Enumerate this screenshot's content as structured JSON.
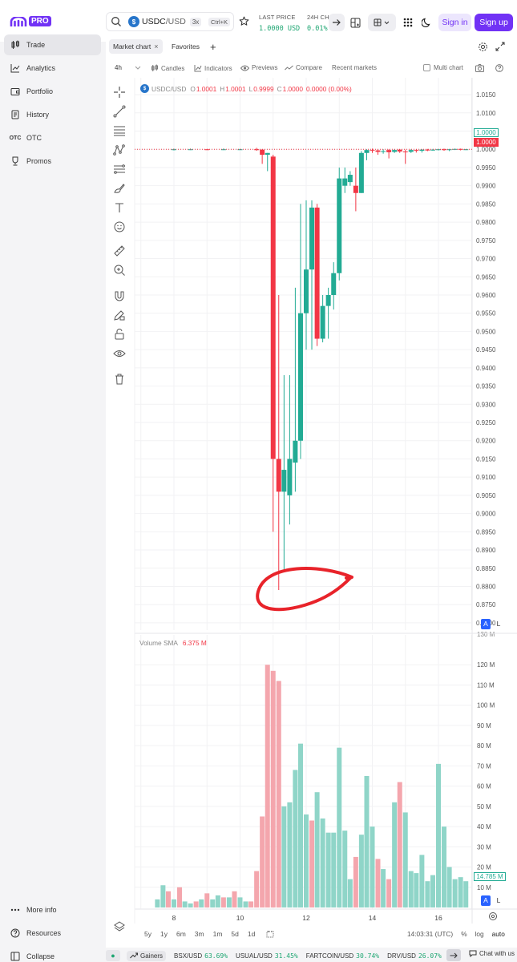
{
  "header": {
    "logo_text": "PRO",
    "pair_base": "USDC",
    "pair_quote": "/USD",
    "leverage": "3x",
    "shortcut": "Ctrl+K",
    "last_price_label": "LAST PRICE",
    "last_price_value": "1.0000 USD",
    "change_label": "24H CHA",
    "change_value": "0.01%",
    "sign_in": "Sign in",
    "sign_up": "Sign up"
  },
  "sidebar": {
    "items": [
      {
        "label": "Trade",
        "icon": "candles-icon"
      },
      {
        "label": "Analytics",
        "icon": "trend-chart-icon"
      },
      {
        "label": "Portfolio",
        "icon": "wallet-icon"
      },
      {
        "label": "History",
        "icon": "history-icon"
      },
      {
        "label": "OTC",
        "icon": "otc-icon"
      },
      {
        "label": "Promos",
        "icon": "trophy-icon"
      }
    ],
    "footer": [
      {
        "label": "More info",
        "icon": "ellipsis-icon"
      },
      {
        "label": "Resources",
        "icon": "help-circle-icon"
      },
      {
        "label": "Collapse",
        "icon": "collapse-icon"
      }
    ]
  },
  "tabs": {
    "market_chart": "Market chart",
    "favorites": "Favorites"
  },
  "toolbar": {
    "interval": "4h",
    "candles": "Candles",
    "indicators": "Indicators",
    "previews": "Previews",
    "compare": "Compare",
    "recent_markets": "Recent markets",
    "multi_chart": "Multi chart"
  },
  "legend": {
    "pair": "USDC/USD",
    "o_label": "O",
    "o": "1.0001",
    "h_label": "H",
    "h": "1.0001",
    "l_label": "L",
    "l": "0.9999",
    "c_label": "C",
    "c": "1.0000",
    "change": "0.0000 (0.00%)",
    "volume_label": "Volume SMA",
    "volume_value": "6.375 M"
  },
  "price_axis": [
    "1.0150",
    "1.0100",
    "1.0050",
    "1.0000",
    "0.9950",
    "0.9900",
    "0.9850",
    "0.9800",
    "0.9750",
    "0.9700",
    "0.9650",
    "0.9600",
    "0.9550",
    "0.9500",
    "0.9450",
    "0.9400",
    "0.9350",
    "0.9300",
    "0.9250",
    "0.9200",
    "0.9150",
    "0.9100",
    "0.9050",
    "0.9000",
    "0.8950",
    "0.8900",
    "0.8850",
    "0.8800",
    "0.8750",
    "0.8700"
  ],
  "price_tags": {
    "ask": "1.0000",
    "last": "1.0000"
  },
  "scale_buttons": {
    "a": "A",
    "l": "L"
  },
  "volume_axis": [
    "120 M",
    "110 M",
    "100 M",
    "90 M",
    "80 M",
    "70 M",
    "60 M",
    "50 M",
    "40 M",
    "30 M",
    "20 M",
    "10 M"
  ],
  "volume_tag": "14.785 M",
  "volume_cut_label": "130 M",
  "time_axis": [
    "8",
    "10",
    "12",
    "14",
    "16"
  ],
  "ranges": [
    "5y",
    "1y",
    "6m",
    "3m",
    "1m",
    "5d",
    "1d"
  ],
  "footer_right": {
    "time": "14:03:31 (UTC)",
    "pct": "%",
    "log": "log",
    "auto": "auto"
  },
  "ticker": {
    "gainers": "Gainers",
    "items": [
      {
        "pair": "BSX/USD",
        "pct": "63.69%"
      },
      {
        "pair": "USUAL/USD",
        "pct": "31.45%"
      },
      {
        "pair": "FARTCOIN/USD",
        "pct": "30.74%"
      },
      {
        "pair": "DRV/USD",
        "pct": "26.07%"
      }
    ],
    "chat": "Chat with us"
  },
  "colors": {
    "brand": "#7132f5",
    "up": "#22ab94",
    "down": "#f23645",
    "vol_up": "#8fd5c8",
    "vol_down": "#f4a6ad",
    "annotation": "#e8232a"
  },
  "chart_data": {
    "type": "candlestick",
    "interval": "4h",
    "ylim": [
      0.868,
      1.017
    ],
    "volume_ylim": [
      0,
      130
    ],
    "candles": [
      {
        "x": 8.0,
        "o": 0.9999,
        "h": 1.0002,
        "l": 0.9997,
        "c": 1.0
      },
      {
        "x": 8.5,
        "o": 1.0,
        "h": 1.0002,
        "l": 0.9998,
        "c": 1.0
      },
      {
        "x": 9.0,
        "o": 1.0,
        "h": 1.0001,
        "l": 0.9998,
        "c": 0.9999
      },
      {
        "x": 9.5,
        "o": 0.9999,
        "h": 1.0002,
        "l": 0.9998,
        "c": 1.0
      },
      {
        "x": 10.0,
        "o": 1.0,
        "h": 1.0001,
        "l": 0.9999,
        "c": 1.0
      },
      {
        "x": 10.5,
        "o": 1.0,
        "h": 1.0004,
        "l": 0.9996,
        "c": 0.9999
      },
      {
        "x": 10.67,
        "o": 0.9999,
        "h": 1.0,
        "l": 0.996,
        "c": 0.9985
      },
      {
        "x": 10.83,
        "o": 0.9985,
        "h": 0.999,
        "l": 0.994,
        "c": 0.999
      },
      {
        "x": 11.0,
        "o": 0.998,
        "h": 0.9985,
        "l": 0.895,
        "c": 0.915
      },
      {
        "x": 11.17,
        "o": 0.915,
        "h": 0.96,
        "l": 0.879,
        "c": 0.906
      },
      {
        "x": 11.33,
        "o": 0.906,
        "h": 0.938,
        "l": 0.884,
        "c": 0.912
      },
      {
        "x": 11.5,
        "o": 0.905,
        "h": 0.938,
        "l": 0.897,
        "c": 0.915
      },
      {
        "x": 11.67,
        "o": 0.914,
        "h": 0.962,
        "l": 0.906,
        "c": 0.92
      },
      {
        "x": 11.83,
        "o": 0.92,
        "h": 0.985,
        "l": 0.915,
        "c": 0.955
      },
      {
        "x": 12.0,
        "o": 0.955,
        "h": 0.986,
        "l": 0.945,
        "c": 0.967
      },
      {
        "x": 12.17,
        "o": 0.967,
        "h": 0.986,
        "l": 0.945,
        "c": 0.984
      },
      {
        "x": 12.33,
        "o": 0.984,
        "h": 0.985,
        "l": 0.946,
        "c": 0.948
      },
      {
        "x": 12.5,
        "o": 0.948,
        "h": 0.96,
        "l": 0.947,
        "c": 0.957
      },
      {
        "x": 12.67,
        "o": 0.957,
        "h": 0.962,
        "l": 0.948,
        "c": 0.96
      },
      {
        "x": 12.83,
        "o": 0.96,
        "h": 0.969,
        "l": 0.956,
        "c": 0.966
      },
      {
        "x": 13.0,
        "o": 0.966,
        "h": 0.995,
        "l": 0.964,
        "c": 0.992
      },
      {
        "x": 13.17,
        "o": 0.99,
        "h": 0.995,
        "l": 0.988,
        "c": 0.992
      },
      {
        "x": 13.33,
        "o": 0.991,
        "h": 0.994,
        "l": 0.99,
        "c": 0.993
      },
      {
        "x": 13.5,
        "o": 0.99,
        "h": 0.995,
        "l": 0.983,
        "c": 0.988
      },
      {
        "x": 13.67,
        "o": 0.988,
        "h": 0.9995,
        "l": 0.988,
        "c": 0.999
      },
      {
        "x": 13.83,
        "o": 0.999,
        "h": 1.0,
        "l": 0.997,
        "c": 0.9998
      },
      {
        "x": 14.0,
        "o": 0.9998,
        "h": 1.0002,
        "l": 0.999,
        "c": 0.9997
      },
      {
        "x": 14.17,
        "o": 0.9997,
        "h": 1.0,
        "l": 0.9985,
        "c": 0.9993
      },
      {
        "x": 14.33,
        "o": 0.9993,
        "h": 1.0,
        "l": 0.9988,
        "c": 0.9995
      },
      {
        "x": 14.5,
        "o": 0.9998,
        "h": 1.0,
        "l": 0.9975,
        "c": 0.9992
      },
      {
        "x": 14.67,
        "o": 0.9993,
        "h": 1.0,
        "l": 0.999,
        "c": 0.9998
      },
      {
        "x": 14.83,
        "o": 0.9999,
        "h": 1.0,
        "l": 0.999,
        "c": 0.9994
      },
      {
        "x": 15.0,
        "o": 0.9994,
        "h": 0.9999,
        "l": 0.996,
        "c": 0.9993
      },
      {
        "x": 15.17,
        "o": 0.9993,
        "h": 1.0,
        "l": 0.999,
        "c": 0.9998
      },
      {
        "x": 15.33,
        "o": 0.9998,
        "h": 1.0,
        "l": 0.9991,
        "c": 0.9996
      },
      {
        "x": 15.5,
        "o": 0.9996,
        "h": 1.0,
        "l": 0.9991,
        "c": 0.9999
      },
      {
        "x": 15.67,
        "o": 0.9999,
        "h": 1.0001,
        "l": 0.9995,
        "c": 0.9998
      },
      {
        "x": 15.83,
        "o": 0.9998,
        "h": 1.0001,
        "l": 0.9996,
        "c": 0.9999
      },
      {
        "x": 16.0,
        "o": 0.9999,
        "h": 1.0001,
        "l": 0.9997,
        "c": 1.0
      },
      {
        "x": 16.17,
        "o": 1.0,
        "h": 1.0002,
        "l": 0.9996,
        "c": 0.9998
      },
      {
        "x": 16.33,
        "o": 0.9998,
        "h": 1.0001,
        "l": 0.9995,
        "c": 1.0
      },
      {
        "x": 16.5,
        "o": 1.0,
        "h": 1.0002,
        "l": 0.9998,
        "c": 1.0001
      },
      {
        "x": 16.67,
        "o": 1.0001,
        "h": 1.0002,
        "l": 0.9997,
        "c": 0.9999
      },
      {
        "x": 16.83,
        "o": 0.9999,
        "h": 1.0001,
        "l": 0.9998,
        "c": 1.0
      }
    ],
    "volume": [
      {
        "x": 7.5,
        "v": 4,
        "up": true
      },
      {
        "x": 7.67,
        "v": 11,
        "up": true
      },
      {
        "x": 7.83,
        "v": 8,
        "up": false
      },
      {
        "x": 8.0,
        "v": 4,
        "up": true
      },
      {
        "x": 8.17,
        "v": 10,
        "up": false
      },
      {
        "x": 8.33,
        "v": 3,
        "up": true
      },
      {
        "x": 8.5,
        "v": 2,
        "up": true
      },
      {
        "x": 8.67,
        "v": 3,
        "up": false
      },
      {
        "x": 8.83,
        "v": 4,
        "up": true
      },
      {
        "x": 9.0,
        "v": 7,
        "up": false
      },
      {
        "x": 9.17,
        "v": 4,
        "up": true
      },
      {
        "x": 9.33,
        "v": 6,
        "up": true
      },
      {
        "x": 9.5,
        "v": 5,
        "up": false
      },
      {
        "x": 9.67,
        "v": 5,
        "up": true
      },
      {
        "x": 9.83,
        "v": 8,
        "up": false
      },
      {
        "x": 10.0,
        "v": 5,
        "up": true
      },
      {
        "x": 10.17,
        "v": 3,
        "up": true
      },
      {
        "x": 10.33,
        "v": 3,
        "up": false
      },
      {
        "x": 10.5,
        "v": 18,
        "up": false
      },
      {
        "x": 10.67,
        "v": 45,
        "up": false
      },
      {
        "x": 10.83,
        "v": 120,
        "up": false
      },
      {
        "x": 11.0,
        "v": 117,
        "up": false
      },
      {
        "x": 11.17,
        "v": 112,
        "up": false
      },
      {
        "x": 11.33,
        "v": 50,
        "up": true
      },
      {
        "x": 11.5,
        "v": 52,
        "up": true
      },
      {
        "x": 11.67,
        "v": 68,
        "up": true
      },
      {
        "x": 11.83,
        "v": 81,
        "up": true
      },
      {
        "x": 12.0,
        "v": 46,
        "up": true
      },
      {
        "x": 12.17,
        "v": 43,
        "up": false
      },
      {
        "x": 12.33,
        "v": 57,
        "up": true
      },
      {
        "x": 12.5,
        "v": 44,
        "up": true
      },
      {
        "x": 12.67,
        "v": 37,
        "up": true
      },
      {
        "x": 12.83,
        "v": 37,
        "up": true
      },
      {
        "x": 13.0,
        "v": 79,
        "up": true
      },
      {
        "x": 13.17,
        "v": 38,
        "up": true
      },
      {
        "x": 13.33,
        "v": 14,
        "up": true
      },
      {
        "x": 13.5,
        "v": 25,
        "up": false
      },
      {
        "x": 13.67,
        "v": 36,
        "up": true
      },
      {
        "x": 13.83,
        "v": 65,
        "up": true
      },
      {
        "x": 14.0,
        "v": 40,
        "up": true
      },
      {
        "x": 14.17,
        "v": 24,
        "up": false
      },
      {
        "x": 14.33,
        "v": 19,
        "up": true
      },
      {
        "x": 14.5,
        "v": 14,
        "up": false
      },
      {
        "x": 14.67,
        "v": 52,
        "up": true
      },
      {
        "x": 14.83,
        "v": 62,
        "up": false
      },
      {
        "x": 15.0,
        "v": 47,
        "up": true
      },
      {
        "x": 15.17,
        "v": 18,
        "up": true
      },
      {
        "x": 15.33,
        "v": 17,
        "up": true
      },
      {
        "x": 15.5,
        "v": 26,
        "up": true
      },
      {
        "x": 15.67,
        "v": 13,
        "up": true
      },
      {
        "x": 15.83,
        "v": 16,
        "up": true
      },
      {
        "x": 16.0,
        "v": 71,
        "up": true
      },
      {
        "x": 16.17,
        "v": 40,
        "up": true
      },
      {
        "x": 16.33,
        "v": 20,
        "up": true
      },
      {
        "x": 16.5,
        "v": 14,
        "up": true
      },
      {
        "x": 16.67,
        "v": 15,
        "up": true
      },
      {
        "x": 16.83,
        "v": 13,
        "up": true
      }
    ]
  }
}
